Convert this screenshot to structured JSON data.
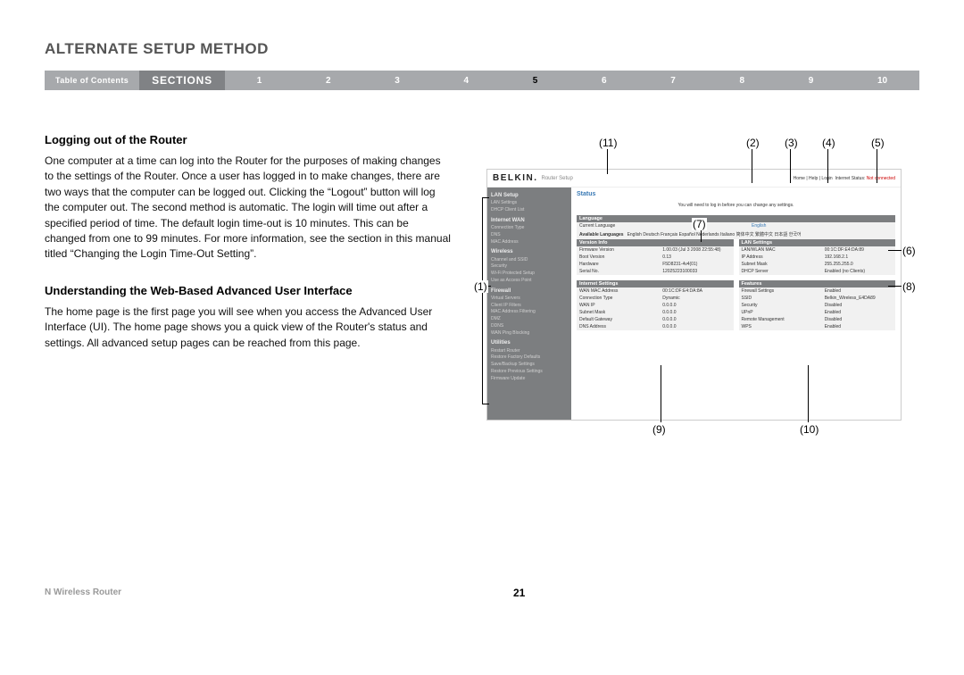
{
  "header": {
    "title": "ALTERNATE SETUP METHOD"
  },
  "nav": {
    "toc": "Table of Contents",
    "sections_label": "SECTIONS",
    "numbers": [
      "1",
      "2",
      "3",
      "4",
      "5",
      "6",
      "7",
      "8",
      "9",
      "10"
    ],
    "active": "5"
  },
  "body": {
    "h1": "Logging out of the Router",
    "p1": "One computer at a time can log into the Router for the purposes of making changes to the settings of the Router. Once a user has logged in to make changes, there are two ways that the computer can be logged out. Clicking the “Logout” button will log the computer out. The second method is automatic. The login will time out after a specified period of time. The default login time-out is 10 minutes. This can be changed from one to 99 minutes. For more information, see the section in this manual titled “Changing the Login Time-Out Setting”.",
    "h2": "Understanding the Web-Based Advanced User Interface",
    "p2": "The home page is the first page you will see when you access the Advanced User Interface (UI). The home page shows you a quick view of the Router's status and settings. All advanced setup pages can be reached from this page."
  },
  "call": {
    "c1": "(1)",
    "c2": "(2)",
    "c3": "(3)",
    "c4": "(4)",
    "c5": "(5)",
    "c6": "(6)",
    "c7": "(7)",
    "c8": "(8)",
    "c9": "(9)",
    "c10": "(10)",
    "c11": "(11)"
  },
  "router": {
    "brand": "BELKIN.",
    "subtitle": "Router Setup",
    "links": {
      "home": "Home",
      "help": "Help",
      "login": "Login",
      "status_label": "Internet Status:",
      "status": "Not connected"
    },
    "status_title": "Status",
    "note": "You will need to log in before you can change any settings.",
    "side": {
      "g0": "LAN Setup",
      "i0a": "LAN Settings",
      "i0b": "DHCP Client List",
      "g1": "Internet WAN",
      "i1a": "Connection Type",
      "i1b": "DNS",
      "i1c": "MAC Address",
      "g2": "Wireless",
      "i2a": "Channel and SSID",
      "i2b": "Security",
      "i2c": "Wi-Fi Protected Setup",
      "i2d": "Use as Access Point",
      "g3": "Firewall",
      "i3a": "Virtual Servers",
      "i3b": "Client IP Filters",
      "i3c": "MAC Address Filtering",
      "i3d": "DMZ",
      "i3e": "DDNS",
      "i3f": "WAN Ping Blocking",
      "g4": "Utilities",
      "i4a": "Restart Router",
      "i4b": "Restore Factory Defaults",
      "i4c": "Save/Backup Settings",
      "i4d": "Restore Previous Settings",
      "i4e": "Firmware Update"
    },
    "lang": {
      "title": "Language",
      "k1": "Current Language",
      "v1": "English",
      "k2": "Available Languages",
      "v2": "English  Deutsch  Français  Español  Nederlands  Italiano  简体中文  繁體中文  日本語  한국어"
    },
    "ver": {
      "title": "Version Info",
      "k1": "Firmware Version",
      "v1": "1.00.03 (Jul 3 2008 22:55:48)",
      "k2": "Boot Version",
      "v2": "0.13",
      "k3": "Hardware",
      "v3": "F5D8231-4v4(01)",
      "k4": "Serial No.",
      "v4": "12025223100033"
    },
    "lan": {
      "title": "LAN Settings",
      "k1": "LAN/WLAN MAC",
      "v1": "00:1C:DF:E4:DA:89",
      "k2": "IP Address",
      "v2": "192.168.2.1",
      "k3": "Subnet Mask",
      "v3": "255.255.255.0",
      "k4": "DHCP Server",
      "v4": "Enabled (no Clients)"
    },
    "net": {
      "title": "Internet Settings",
      "k1": "WAN MAC Address",
      "v1": "00:1C:DF:E4:DA:8A",
      "k2": "Connection Type",
      "v2": "Dynamic",
      "k3": "WAN IP",
      "v3": "0.0.0.0",
      "k4": "Subnet Mask",
      "v4": "0.0.0.0",
      "k5": "Default Gateway",
      "v5": "0.0.0.0",
      "k6": "DNS Address",
      "v6": "0.0.0.0"
    },
    "feat": {
      "title": "Features",
      "k1": "Firewall Settings",
      "v1": "Enabled",
      "k2": "SSID",
      "v2": "Belkin_Wireless_E4DA89",
      "k3": "Security",
      "v3": "Disabled",
      "k4": "UPnP",
      "v4": "Enabled",
      "k5": "Remote Management",
      "v5": "Disabled",
      "k6": "WPS",
      "v6": "Enabled"
    }
  },
  "footer": {
    "left": "N Wireless Router",
    "page": "21"
  }
}
